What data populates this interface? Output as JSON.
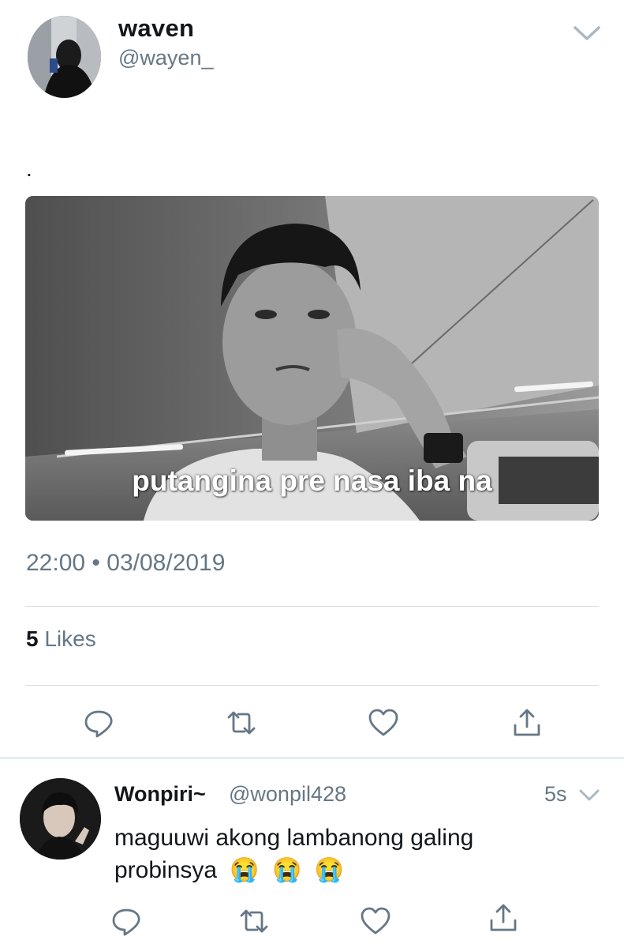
{
  "tweet": {
    "author": {
      "display_name": "waven",
      "handle": "@wayen_"
    },
    "text": ".",
    "media": {
      "caption": "putangina pre nasa iba na"
    },
    "timestamp": "22:00",
    "separator": "•",
    "date": "03/08/2019",
    "likes_count": "5",
    "likes_label": "Likes",
    "actions": [
      "reply-icon",
      "retweet-icon",
      "like-icon",
      "share-icon"
    ]
  },
  "reply": {
    "author": {
      "display_name": "Wonpiri~",
      "handle": "@wonpil428"
    },
    "time": "5s",
    "text": "maguuwi akong lambanong galing probinsya",
    "emoji": [
      "😭",
      "😭",
      "😭"
    ],
    "actions": [
      "reply-icon",
      "retweet-icon",
      "like-icon",
      "share-icon"
    ]
  },
  "colors": {
    "text": "#14171a",
    "secondary": "#657786",
    "divider": "#d5dbe0",
    "icon": "#657786"
  }
}
